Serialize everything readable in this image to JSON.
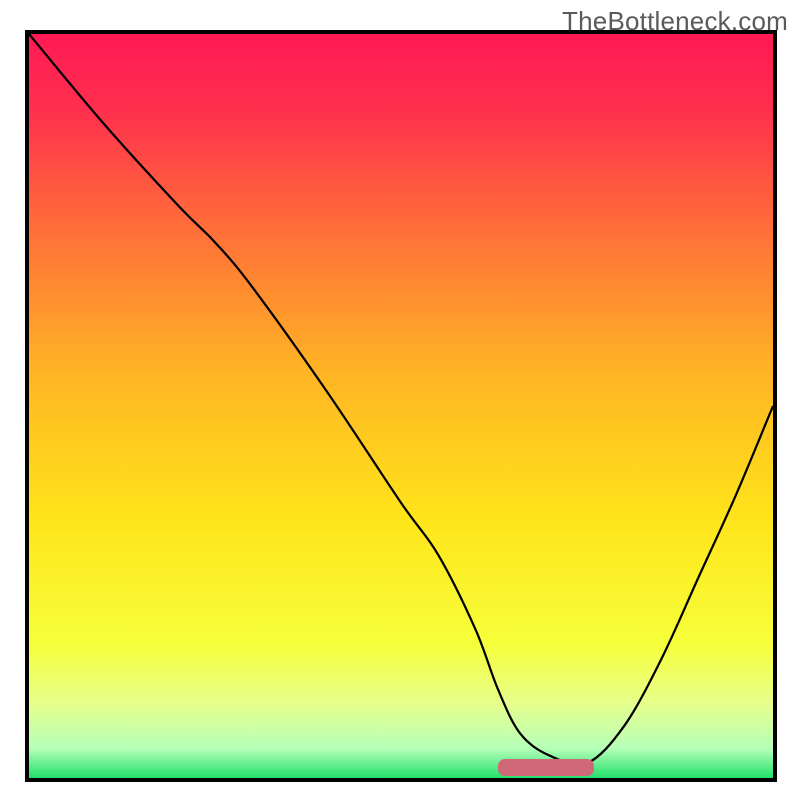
{
  "watermark": "TheBottleneck.com",
  "chart_data": {
    "type": "line",
    "title": "",
    "xlabel": "",
    "ylabel": "",
    "xlim": [
      0,
      100
    ],
    "ylim": [
      0,
      100
    ],
    "grid": false,
    "x": [
      0,
      10,
      20,
      25,
      30,
      40,
      50,
      55,
      60,
      63,
      66,
      70,
      75,
      80,
      85,
      90,
      95,
      100
    ],
    "values": [
      100,
      88,
      77,
      72,
      66,
      52,
      37,
      30,
      20,
      12,
      6,
      3,
      2,
      7,
      16,
      27,
      38,
      50
    ],
    "gradient_stops": [
      {
        "pos": 0.0,
        "color": "#ff1a55"
      },
      {
        "pos": 0.1,
        "color": "#ff2f4e"
      },
      {
        "pos": 0.25,
        "color": "#ff6a3a"
      },
      {
        "pos": 0.45,
        "color": "#ffb324"
      },
      {
        "pos": 0.65,
        "color": "#ffe41a"
      },
      {
        "pos": 0.82,
        "color": "#f6ff3a"
      },
      {
        "pos": 0.9,
        "color": "#e6ff8c"
      },
      {
        "pos": 0.96,
        "color": "#b6ffb8"
      },
      {
        "pos": 1.0,
        "color": "#22e06a"
      }
    ],
    "highlight_bar": {
      "x_start": 63,
      "x_end": 76,
      "y": 1.4,
      "height": 2.2,
      "color": "#cf6977"
    }
  }
}
